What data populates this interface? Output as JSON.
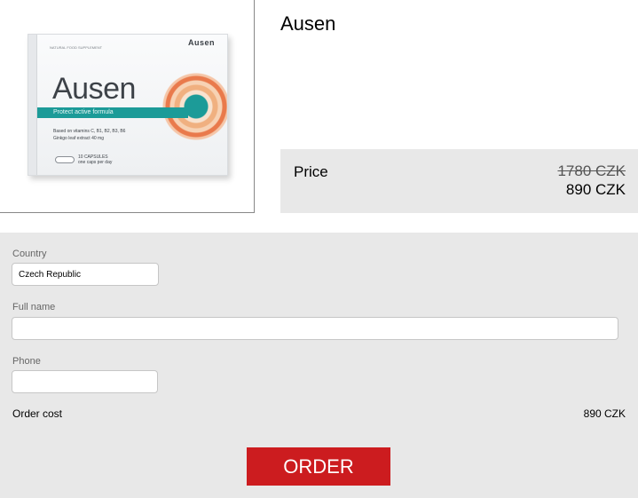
{
  "product": {
    "title": "Ausen",
    "box": {
      "brand_top": "Ausen",
      "tag": "Natural food supplement",
      "title": "Ausen",
      "band": "Protect active formula",
      "vitamins_line1": "Based on vitamins C, B1, B2, B3, B6",
      "vitamins_line2": "Ginkgo leaf extract 40 mg",
      "capsules_line1": "10 CAPSULES",
      "capsules_line2": "one caps per day",
      "accent_color": "#1c9b98"
    }
  },
  "price": {
    "label": "Price",
    "old_price": "1780 CZK",
    "new_price": "890 CZK"
  },
  "form": {
    "country_label": "Country",
    "country_value": "Czech Republic",
    "fullname_label": "Full name",
    "fullname_value": "",
    "phone_label": "Phone",
    "phone_value": "",
    "order_cost_label": "Order cost",
    "order_cost_value": "890 CZK",
    "order_button": "ORDER",
    "button_color": "#cc1c1f"
  }
}
